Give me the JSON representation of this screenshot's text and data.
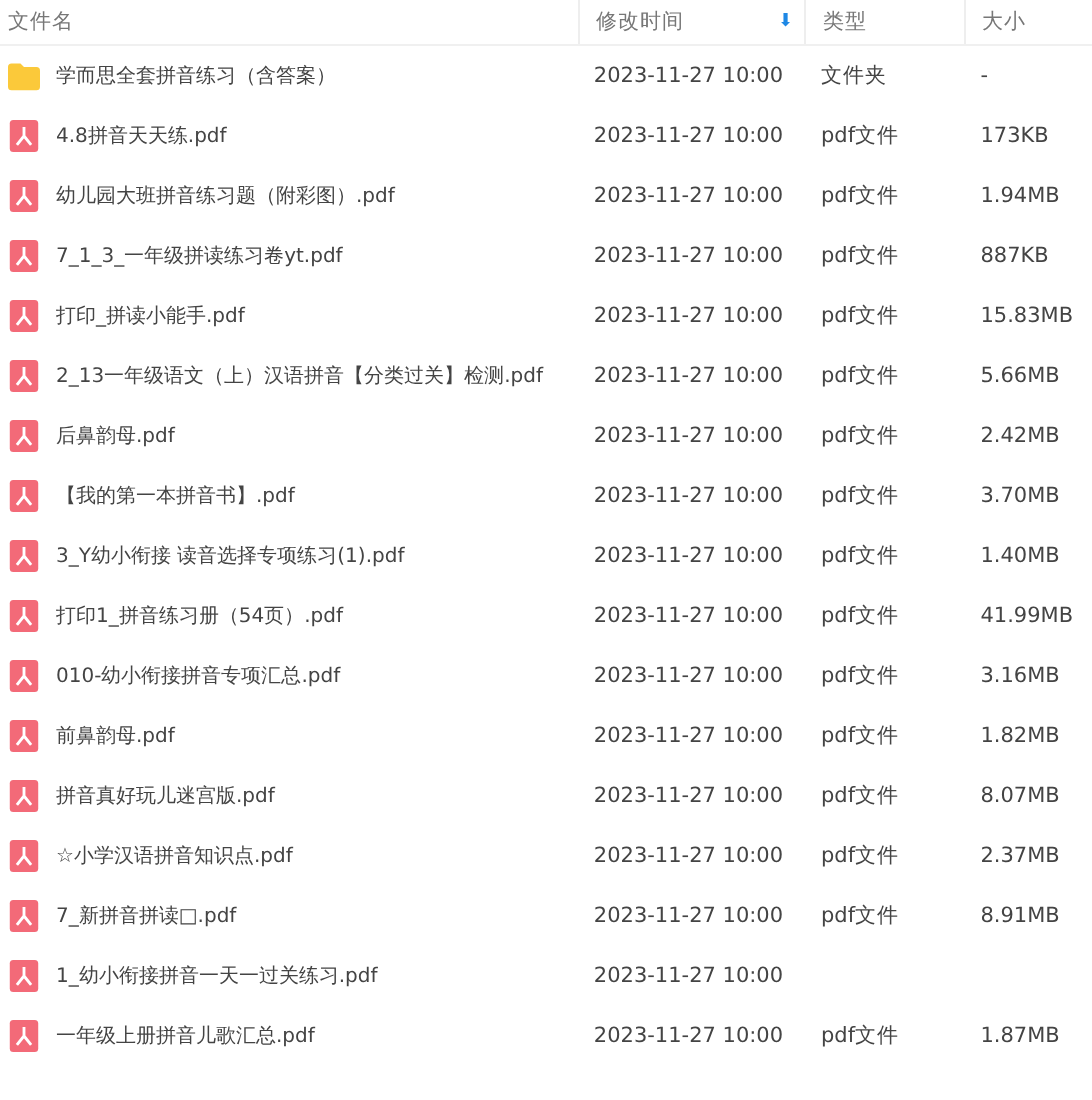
{
  "columns": [
    {
      "label": "文件名",
      "sorted": false
    },
    {
      "label": "修改时间",
      "sorted": true
    },
    {
      "label": "类型",
      "sorted": false
    },
    {
      "label": "大小",
      "sorted": false
    }
  ],
  "sort_icon": "⬇",
  "rows": [
    {
      "kind": "folder",
      "name": "学而思全套拼音练习（含答案）",
      "modified": "2023-11-27 10:00",
      "type": "文件夹",
      "size": "-"
    },
    {
      "kind": "pdf",
      "name": "4.8拼音天天练.pdf",
      "modified": "2023-11-27 10:00",
      "type": "pdf文件",
      "size": "173KB"
    },
    {
      "kind": "pdf",
      "name": "幼儿园大班拼音练习题（附彩图）.pdf",
      "modified": "2023-11-27 10:00",
      "type": "pdf文件",
      "size": "1.94MB"
    },
    {
      "kind": "pdf",
      "name": "7_1_3_一年级拼读练习卷yt.pdf",
      "modified": "2023-11-27 10:00",
      "type": "pdf文件",
      "size": "887KB"
    },
    {
      "kind": "pdf",
      "name": "打印_拼读小能手.pdf",
      "modified": "2023-11-27 10:00",
      "type": "pdf文件",
      "size": "15.83MB"
    },
    {
      "kind": "pdf",
      "name": "2_13一年级语文（上）汉语拼音【分类过关】检测.pdf",
      "modified": "2023-11-27 10:00",
      "type": "pdf文件",
      "size": "5.66MB"
    },
    {
      "kind": "pdf",
      "name": "后鼻韵母.pdf",
      "modified": "2023-11-27 10:00",
      "type": "pdf文件",
      "size": "2.42MB"
    },
    {
      "kind": "pdf",
      "name": "【我的第一本拼音书】.pdf",
      "modified": "2023-11-27 10:00",
      "type": "pdf文件",
      "size": "3.70MB"
    },
    {
      "kind": "pdf",
      "name": "3_Y幼小衔接 读音选择专项练习(1).pdf",
      "modified": "2023-11-27 10:00",
      "type": "pdf文件",
      "size": "1.40MB"
    },
    {
      "kind": "pdf",
      "name": "打印1_拼音练习册（54页）.pdf",
      "modified": "2023-11-27 10:00",
      "type": "pdf文件",
      "size": "41.99MB"
    },
    {
      "kind": "pdf",
      "name": "010-幼小衔接拼音专项汇总.pdf",
      "modified": "2023-11-27 10:00",
      "type": "pdf文件",
      "size": "3.16MB"
    },
    {
      "kind": "pdf",
      "name": "前鼻韵母.pdf",
      "modified": "2023-11-27 10:00",
      "type": "pdf文件",
      "size": "1.82MB"
    },
    {
      "kind": "pdf",
      "name": "拼音真好玩儿迷宫版.pdf",
      "modified": "2023-11-27 10:00",
      "type": "pdf文件",
      "size": "8.07MB"
    },
    {
      "kind": "pdf",
      "name": "☆小学汉语拼音知识点.pdf",
      "modified": "2023-11-27 10:00",
      "type": "pdf文件",
      "size": "2.37MB"
    },
    {
      "kind": "pdf",
      "name": "7_新拼音拼读□.pdf",
      "modified": "2023-11-27 10:00",
      "type": "pdf文件",
      "size": "8.91MB"
    },
    {
      "kind": "pdf",
      "name": "1_幼小衔接拼音一天一过关练习.pdf",
      "modified": "2023-11-27 10:00"
    },
    {
      "kind": "pdf",
      "name": "一年级上册拼音儿歌汇总.pdf",
      "modified": "2023-11-27 10:00",
      "type": "pdf文件",
      "size": "1.87MB"
    }
  ]
}
